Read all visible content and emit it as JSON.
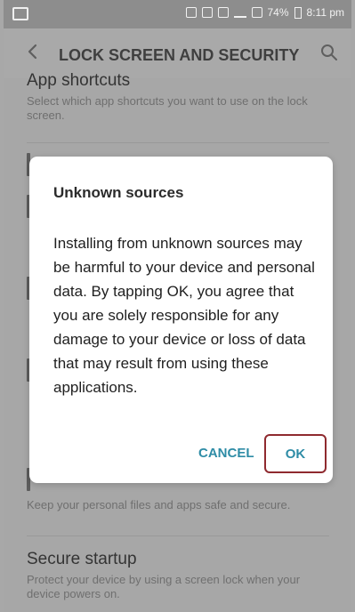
{
  "status_bar": {
    "battery": "74%",
    "time": "8:11 pm"
  },
  "header": {
    "title": "LOCK SCREEN AND SECURITY"
  },
  "items": [
    {
      "title": "App shortcuts",
      "subtitle": "Select which app shortcuts you want to use on the lock screen."
    },
    {
      "title": "",
      "subtitle": "Keep your personal files and apps safe and secure."
    },
    {
      "title": "Secure startup",
      "subtitle": "Protect your device by using a screen lock when your device powers on."
    }
  ],
  "dialog": {
    "title": "Unknown sources",
    "message": "Installing from unknown sources may be harmful to your device and personal data. By tapping OK, you agree that you are solely responsible for any damage to your device or loss of data that may result from using these applications.",
    "cancel_label": "CANCEL",
    "ok_label": "OK"
  },
  "icons": {
    "back": "back-arrow",
    "search": "search-icon"
  },
  "colors": {
    "accent": "#2e8ca6",
    "ok_highlight": "#8f2a2f"
  }
}
